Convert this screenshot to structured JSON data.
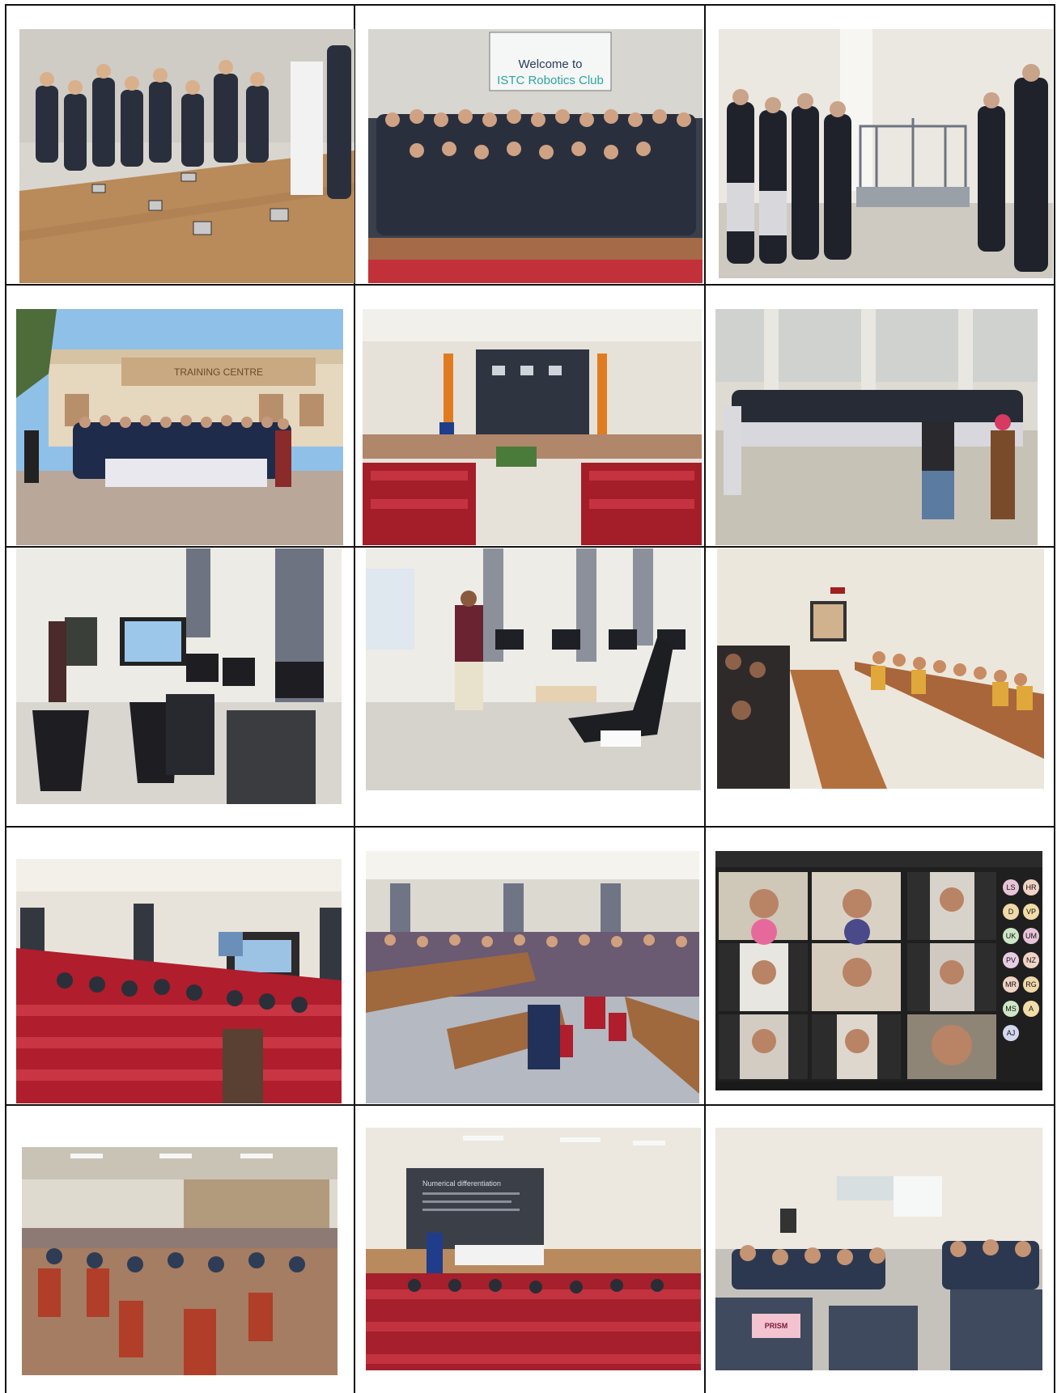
{
  "page": {
    "title": ""
  },
  "photos": [
    {
      "id": "robots-demo",
      "subject": "students watching small robots on wooden stage"
    },
    {
      "id": "robotics-club",
      "subject": "group photo under welcome screen",
      "screen_text_line1": "Welcome to",
      "screen_text_line2": "ISTC Robotics Club"
    },
    {
      "id": "lab-visit",
      "subject": "students at automation lab equipment"
    },
    {
      "id": "building-group",
      "subject": "group in front of training centre building",
      "sign_text": "TRAINING CENTRE"
    },
    {
      "id": "auditorium-stage",
      "subject": "auditorium with panel on stage"
    },
    {
      "id": "hall-gathering",
      "subject": "students in a circle in a large hall"
    },
    {
      "id": "computer-lab",
      "subject": "computer lab with presenter"
    },
    {
      "id": "lecture-room",
      "subject": "instructor with device in classroom"
    },
    {
      "id": "conference-table",
      "subject": "participants at long conference table"
    },
    {
      "id": "auditorium-audience",
      "subject": "audience in red seats"
    },
    {
      "id": "seminar-hall",
      "subject": "crowded seminar hall"
    },
    {
      "id": "online-meeting",
      "subject": "video call grid",
      "avatars": [
        "LS",
        "HR",
        "D",
        "VP",
        "UK",
        "UM",
        "PV",
        "NZ",
        "MR",
        "RG",
        "MS",
        "A",
        "AJ"
      ]
    },
    {
      "id": "workshop-hall",
      "subject": "participants in workshop hall"
    },
    {
      "id": "presentation-hall",
      "subject": "presentation in auditorium",
      "slide_title": "Numerical differentiation"
    },
    {
      "id": "classroom-session",
      "subject": "students in classroom",
      "sign_text": "PRISM"
    }
  ],
  "colors": {
    "border": "#111111",
    "seat_red": "#b3202a",
    "wall": "#e8e4dc",
    "floor_wood": "#b98a5a"
  }
}
